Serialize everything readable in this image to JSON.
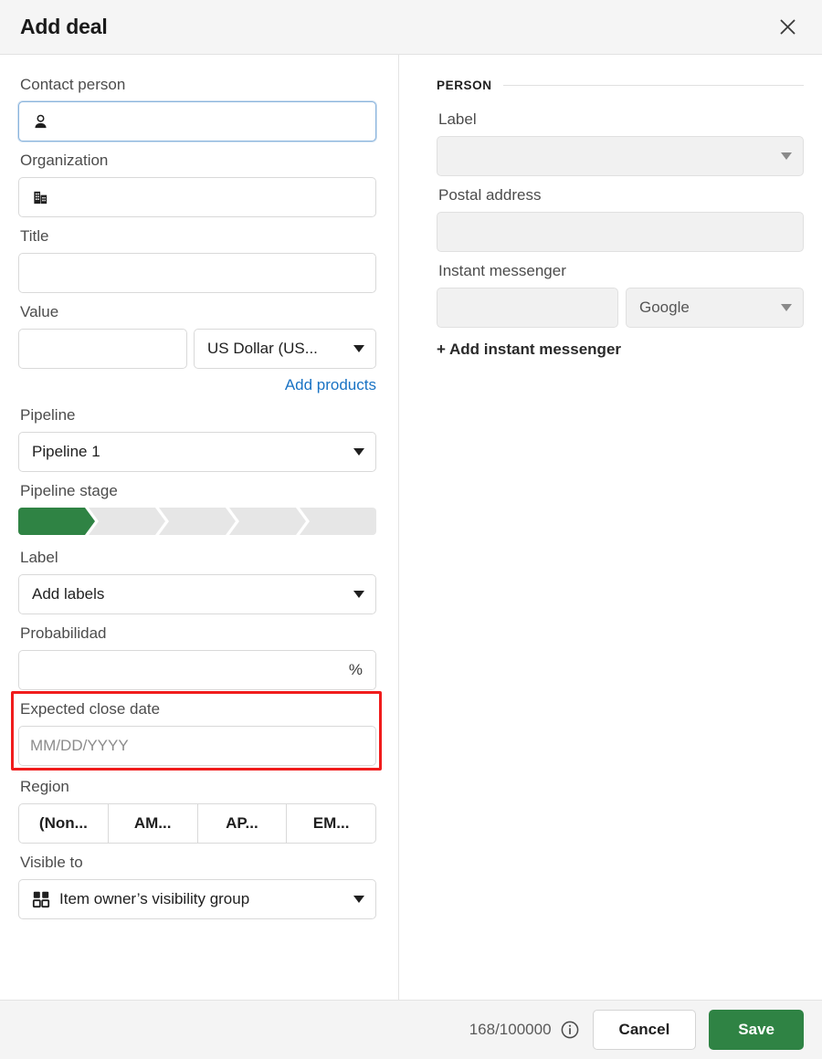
{
  "header": {
    "title": "Add deal",
    "close_icon": "close-icon"
  },
  "left_panel": {
    "contact_person": {
      "label": "Contact person",
      "value": "",
      "placeholder": "",
      "icon": "person-icon",
      "focused": true
    },
    "organization": {
      "label": "Organization",
      "value": "",
      "placeholder": "",
      "icon": "building-icon"
    },
    "title_field": {
      "label": "Title",
      "value": "",
      "placeholder": ""
    },
    "value_field": {
      "label": "Value",
      "value": "",
      "placeholder": "",
      "currency": "US Dollar (US...",
      "add_products_link": "Add products"
    },
    "pipeline": {
      "label": "Pipeline",
      "value": "Pipeline 1"
    },
    "pipeline_stage": {
      "label": "Pipeline stage",
      "total_stages": 5,
      "active_stage": 1,
      "active_color": "#2f8344",
      "inactive_color": "#e6e6e6"
    },
    "deal_label": {
      "label": "Label",
      "value": "Add labels"
    },
    "probability": {
      "label": "Probabilidad",
      "value": "",
      "suffix": "%"
    },
    "expected_close_date": {
      "label": "Expected close date",
      "value": "",
      "placeholder": "MM/DD/YYYY",
      "highlighted": true,
      "highlight_color": "#f01c1c"
    },
    "region": {
      "label": "Region",
      "options": [
        "(Non...",
        "AM...",
        "AP...",
        "EM..."
      ],
      "selected": null
    },
    "visible_to": {
      "label": "Visible to",
      "value": "Item owner’s visibility group",
      "icon": "grid-icon"
    }
  },
  "right_panel": {
    "section_title": "PERSON",
    "person_label": {
      "label": "Label",
      "value": "",
      "disabled": true
    },
    "postal_address": {
      "label": "Postal address",
      "value": "",
      "disabled": true
    },
    "instant_messenger": {
      "label": "Instant messenger",
      "value": "",
      "provider": "Google",
      "disabled": true,
      "add_link": "+ Add instant messenger"
    }
  },
  "footer": {
    "counter": "168/100000",
    "info_icon": "info-icon",
    "cancel_label": "Cancel",
    "save_label": "Save",
    "save_color": "#2f8344"
  }
}
